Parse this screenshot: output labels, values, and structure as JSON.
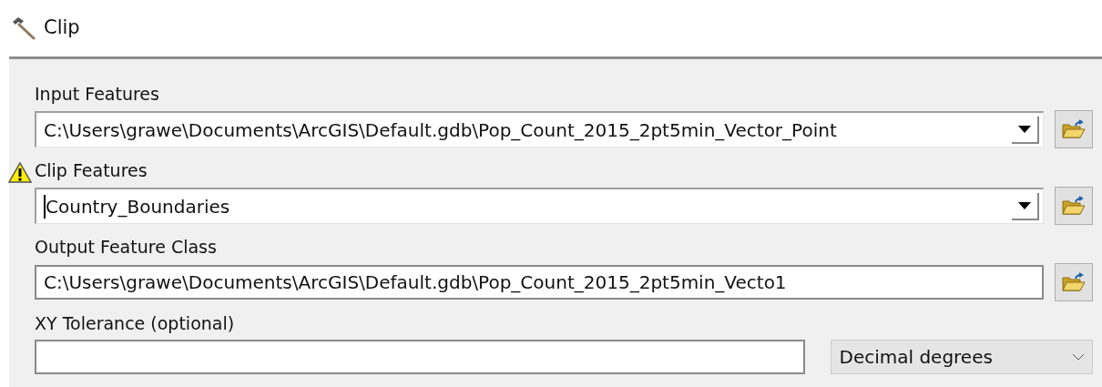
{
  "window": {
    "title": "Clip"
  },
  "parameters": [
    {
      "kind": "combo",
      "label": "Input Features",
      "value": "C:\\Users\\grawe\\Documents\\ArcGIS\\Default.gdb\\Pop_Count_2015_2pt5min_Vector_Point",
      "warning": false,
      "focused": false
    },
    {
      "kind": "combo",
      "label": "Clip Features",
      "value": "Country_Boundaries",
      "warning": true,
      "focused": true
    },
    {
      "kind": "text",
      "label": "Output Feature Class",
      "value": "C:\\Users\\grawe\\Documents\\ArcGIS\\Default.gdb\\Pop_Count_2015_2pt5min_Vecto1",
      "warning": false,
      "focused": false
    },
    {
      "kind": "tolerance",
      "label": "XY Tolerance (optional)",
      "unit": "Decimal degrees",
      "warning": false,
      "focused": false
    }
  ]
}
